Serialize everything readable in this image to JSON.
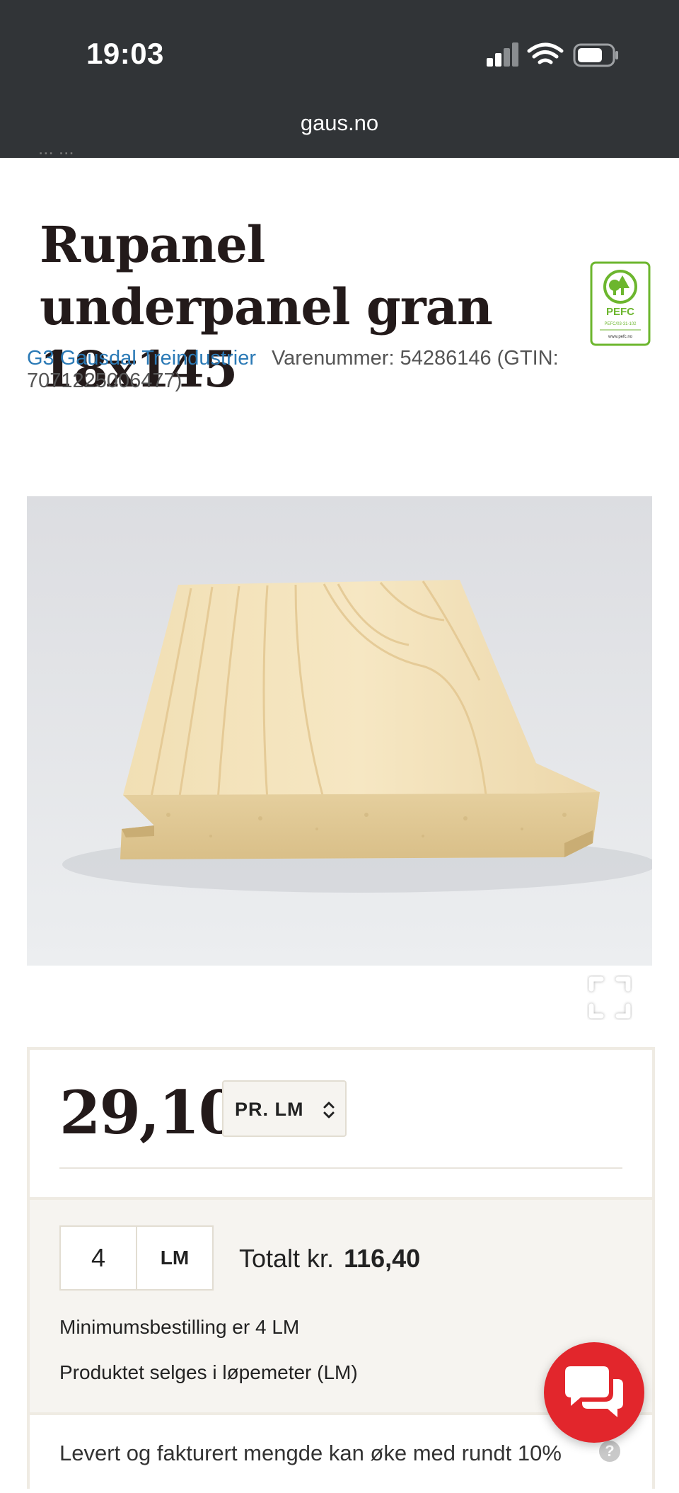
{
  "status_bar": {
    "time": "19:03",
    "url": "gaus.no",
    "icons": [
      "signal-icon",
      "wifi-icon",
      "battery-icon"
    ]
  },
  "breadcrumb_partial": "... ...",
  "product": {
    "title": "Rupanel underpanel gran 18x145",
    "brand": "G3 Gausdal Treindustrier",
    "sku_text": "Varenummer: 54286146 (GTIN: 7071225006477)",
    "certification": {
      "label": "PEFC",
      "sub": "PEFC/03-31-102",
      "url_text": "www.pefc.no"
    }
  },
  "pricing": {
    "price": "29,10",
    "unit_select": "PR. LM"
  },
  "order": {
    "quantity": "4",
    "quantity_unit": "LM",
    "total_label": "Totalt kr.",
    "total_value": "116,40",
    "min_order": "Minimumsbestilling er 4 LM",
    "sold_per": "Produktet selges i løpemeter (LM)"
  },
  "delivery_note": "Levert og fakturert mengde kan øke med rundt 10%",
  "help_label": "?",
  "colors": {
    "status_bar": "#313437",
    "brand_link": "#2b7ab6",
    "title": "#231a1a",
    "chat_button": "#e2262c",
    "pefc_green": "#6cb62e",
    "panel_bg": "#f6f4f0"
  }
}
